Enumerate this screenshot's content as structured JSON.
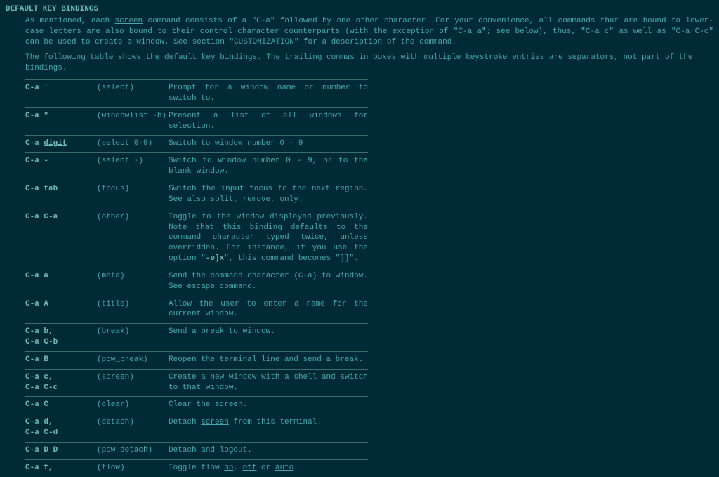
{
  "heading": "DEFAULT KEY BINDINGS",
  "intro_parts": [
    "As  mentioned, each ",
    "screen",
    " command consists of a \"C-a\" followed by one other character.  For your convenience, all commands that are bound to lower-case letters are also bound to their control character counterparts (with the exception of \"C-a a\"; see below), thus, \"C-a c\" as well as \"C-a C-c\" can be used to create a window.  See  section  \"CUSTOMIZATION\" for a description of the command."
  ],
  "para2": "The following table shows the default key bindings. The trailing commas in boxes with multiple keystroke entries are separators, not part of the bindings.",
  "rows": [
    {
      "keys": [
        {
          "pre": "C-a '",
          "u": "",
          "post": ""
        }
      ],
      "cmd": "(select)",
      "desc_parts": [
        "Prompt  for  a window name or number to switch to."
      ]
    },
    {
      "keys": [
        {
          "pre": "C-a \"",
          "u": "",
          "post": ""
        }
      ],
      "cmd": "(windowlist -b)",
      "desc_parts": [
        "Present a list of all windows for selection."
      ]
    },
    {
      "keys": [
        {
          "pre": "C-a ",
          "u": "digit",
          "post": ""
        }
      ],
      "cmd": "(select 0-9)",
      "desc_parts": [
        "Switch to window number 0 - 9"
      ]
    },
    {
      "keys": [
        {
          "pre": "C-a -",
          "u": "",
          "post": ""
        }
      ],
      "cmd": "(select -)",
      "desc_parts": [
        "Switch to window number 0 - 9, or to the blank window."
      ]
    },
    {
      "keys": [
        {
          "pre": "C-a tab",
          "u": "",
          "post": ""
        }
      ],
      "cmd": "(focus)",
      "desc_parts": [
        "Switch  the  input  focus  to the next region.  See also ",
        "split",
        ", ",
        "remove",
        ", ",
        "only",
        "."
      ]
    },
    {
      "keys": [
        {
          "pre": "C-a C-a",
          "u": "",
          "post": ""
        }
      ],
      "cmd": "(other)",
      "desc_parts": [
        "Toggle to  the  window  displayed  previously.  Note that this binding defaults to the command character typed twice, unless overridden.  For instance,  if  you use the option \"",
        "-e]x",
        "\", this command becomes \"]]\"."
      ],
      "bold_idx": 1
    },
    {
      "keys": [
        {
          "pre": "C-a a",
          "u": "",
          "post": ""
        }
      ],
      "cmd": "(meta)",
      "desc_parts": [
        "Send the command character  (C-a)  to  window.  See ",
        "escape",
        " command."
      ]
    },
    {
      "keys": [
        {
          "pre": "C-a A",
          "u": "",
          "post": ""
        }
      ],
      "cmd": "(title)",
      "desc_parts": [
        "Allow the user to enter a name for the current window."
      ]
    },
    {
      "keys": [
        {
          "pre": "C-a b,",
          "u": "",
          "post": ""
        },
        {
          "pre": "C-a C-b",
          "u": "",
          "post": ""
        }
      ],
      "cmd": "(break)",
      "desc_parts": [
        "Send a break to window."
      ]
    },
    {
      "keys": [
        {
          "pre": "C-a B",
          "u": "",
          "post": ""
        }
      ],
      "cmd": "(pow_break)",
      "desc_parts": [
        "Reopen the terminal line and send a break."
      ]
    },
    {
      "keys": [
        {
          "pre": "C-a c,",
          "u": "",
          "post": ""
        },
        {
          "pre": "C-a C-c",
          "u": "",
          "post": ""
        }
      ],
      "cmd": "(screen)",
      "desc_parts": [
        "Create a new window with a shell and switch to that window."
      ]
    },
    {
      "keys": [
        {
          "pre": "C-a C",
          "u": "",
          "post": ""
        }
      ],
      "cmd": "(clear)",
      "desc_parts": [
        "Clear the screen."
      ]
    },
    {
      "keys": [
        {
          "pre": "C-a d,",
          "u": "",
          "post": ""
        },
        {
          "pre": "C-a C-d",
          "u": "",
          "post": ""
        }
      ],
      "cmd": "(detach)",
      "desc_parts": [
        "Detach ",
        "screen",
        " from this terminal."
      ]
    },
    {
      "keys": [
        {
          "pre": "C-a D D",
          "u": "",
          "post": ""
        }
      ],
      "cmd": "(pow_detach)",
      "desc_parts": [
        "Detach and logout."
      ]
    },
    {
      "keys": [
        {
          "pre": "C-a f,",
          "u": "",
          "post": ""
        }
      ],
      "cmd": "(flow)",
      "desc_parts": [
        "Toggle flow ",
        "on",
        ", ",
        "off",
        " or ",
        "auto",
        "."
      ]
    }
  ]
}
